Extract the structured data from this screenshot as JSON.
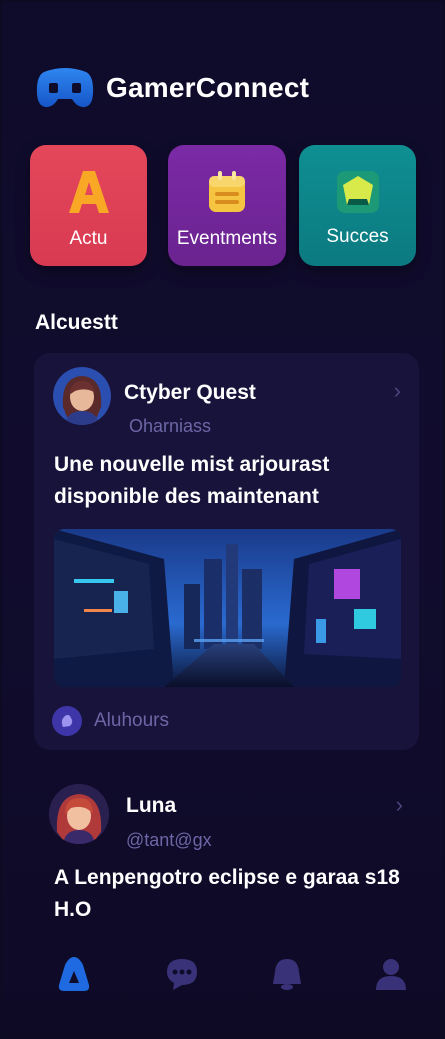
{
  "app": {
    "title": "GamerConnect"
  },
  "categories": [
    {
      "label": "Actu",
      "color": "#e4465a"
    },
    {
      "label": "Eventments",
      "color": "#7b2aa6"
    },
    {
      "label": "Succes",
      "color": "#0f8f92"
    }
  ],
  "section": {
    "title": "Alcuestt"
  },
  "posts": [
    {
      "author": "Ctyber Quest",
      "handle": "Oharniass",
      "text": "Une nouvelle mist arjourast disponible des maintenant",
      "footer": "Aluhours"
    },
    {
      "author": "Luna",
      "handle": "@tant@gx",
      "text": "A Lenpengotro eclipse e garaa s18 H.O"
    }
  ],
  "nav": {
    "items": [
      {
        "icon": "home-icon",
        "active": true
      },
      {
        "icon": "chat-icon",
        "active": false
      },
      {
        "icon": "bell-icon",
        "active": false
      },
      {
        "icon": "profile-icon",
        "active": false
      }
    ]
  },
  "colors": {
    "background": "#0d0a24",
    "card": "#18133a",
    "accent": "#1f6ae0",
    "muted": "#6d66a6"
  }
}
